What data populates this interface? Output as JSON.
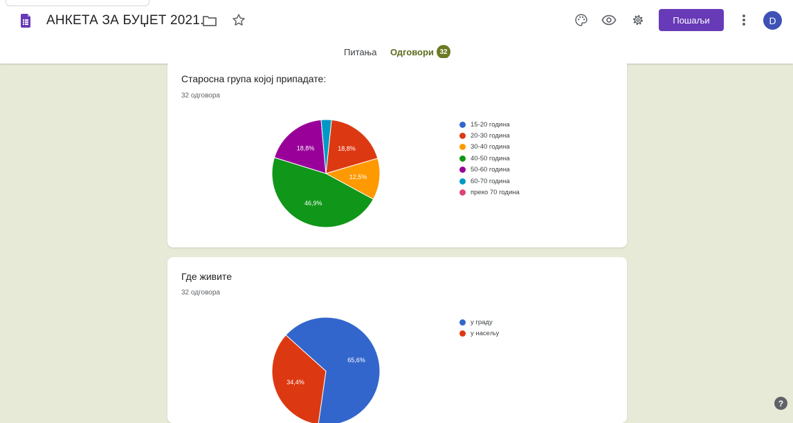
{
  "header": {
    "doc_title": "АНКЕТА ЗА БУЏЕТ 2021.",
    "send_label": "Пошаљи",
    "avatar_letter": "D",
    "icons": [
      "form-icon",
      "folder-icon",
      "star-icon",
      "palette-icon",
      "eye-icon",
      "gear-icon",
      "more-vert-icon"
    ]
  },
  "tabs": {
    "questions": "Питања",
    "responses": "Одговори",
    "responses_count": "32"
  },
  "cards": [
    {
      "title": "Старосна група којој припадате:",
      "count": "32 одговора",
      "chart_data": {
        "type": "pie",
        "labels": [
          "15-20 година",
          "20-30 година",
          "30-40 година",
          "40-50 година",
          "50-60 година",
          "60-70 година",
          "преко 70 година"
        ],
        "values": [
          0,
          18.8,
          12.5,
          46.9,
          18.8,
          3.1,
          0
        ],
        "colors": [
          "#3366cc",
          "#dc3912",
          "#ff9900",
          "#109618",
          "#990099",
          "#0099c6",
          "#dd4477"
        ],
        "data_labels": [
          "",
          "18,8%",
          "12,5%",
          "46,9%",
          "18,8%",
          "",
          ""
        ],
        "legend_position": "right"
      }
    },
    {
      "title": "Где живите",
      "count": "32 одговора",
      "chart_data": {
        "type": "pie",
        "labels": [
          "у граду",
          "у насељу"
        ],
        "values": [
          65.6,
          34.4
        ],
        "colors": [
          "#3366cc",
          "#dc3912"
        ],
        "data_labels": [
          "65,6%",
          "34,4%"
        ],
        "legend_position": "right"
      }
    }
  ],
  "help_label": "?"
}
